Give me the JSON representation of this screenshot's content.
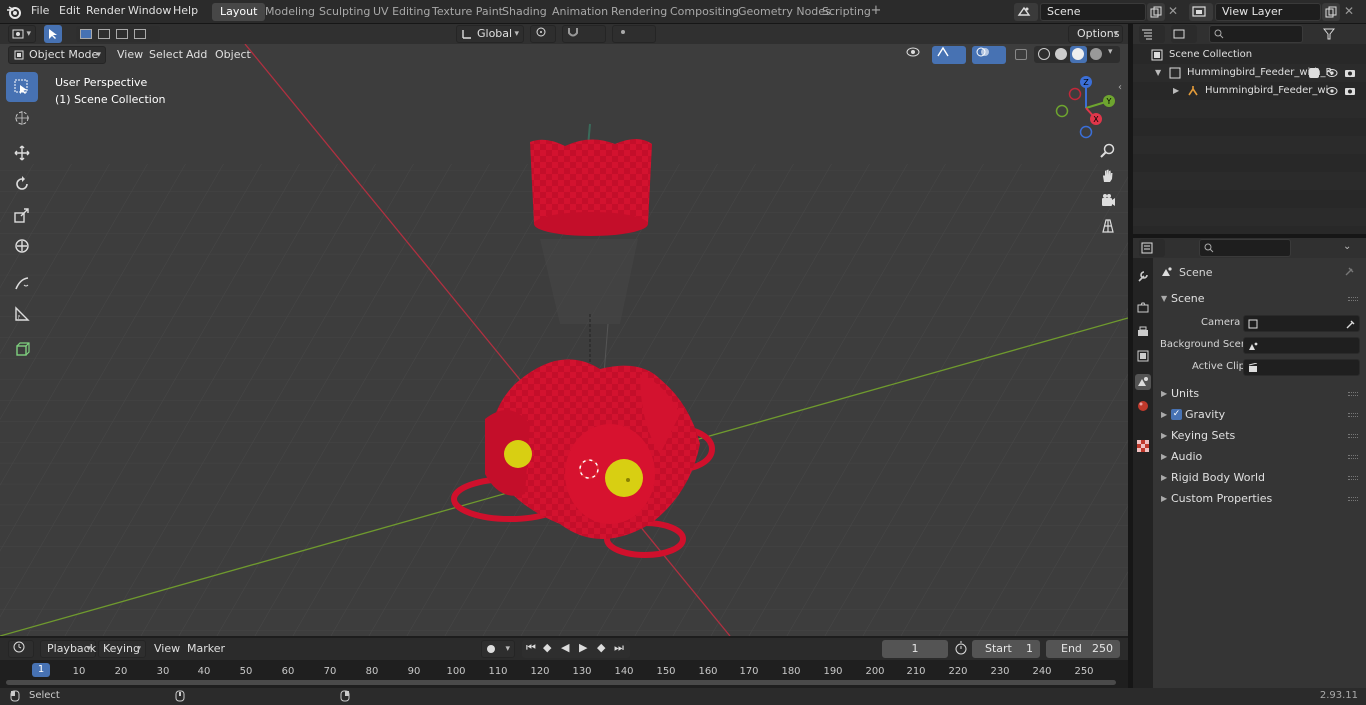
{
  "menu": {
    "file": "File",
    "edit": "Edit",
    "render": "Render",
    "window": "Window",
    "help": "Help"
  },
  "workspaces": [
    {
      "label": "Layout",
      "active": true
    },
    {
      "label": "Modeling"
    },
    {
      "label": "Sculpting"
    },
    {
      "label": "UV Editing"
    },
    {
      "label": "Texture Paint"
    },
    {
      "label": "Shading"
    },
    {
      "label": "Animation"
    },
    {
      "label": "Rendering"
    },
    {
      "label": "Compositing"
    },
    {
      "label": "Geometry Nodes"
    },
    {
      "label": "Scripting"
    }
  ],
  "scene_field": "Scene",
  "view_layer_field": "View Layer",
  "viewport": {
    "mode": "Object Mode",
    "view": "View",
    "select": "Select",
    "add": "Add",
    "object": "Object",
    "orientation": "Global",
    "options": "Options",
    "info_line1": "User Perspective",
    "info_line2": "(1) Scene Collection"
  },
  "gizmo": {
    "x": "X",
    "y": "Y",
    "z": "Z"
  },
  "outliner": {
    "root": "Scene Collection",
    "row1": "Hummingbird_Feeder_with_R",
    "row2": "Hummingbird_Feeder_wi"
  },
  "properties": {
    "header": "Scene",
    "panel_scene": "Scene",
    "camera_label": "Camera",
    "background_label": "Background Scene",
    "clip_label": "Active Clip",
    "panels": [
      "Units",
      "Gravity",
      "Keying Sets",
      "Audio",
      "Rigid Body World",
      "Custom Properties"
    ]
  },
  "timeline": {
    "playback": "Playback",
    "keying": "Keying",
    "view": "View",
    "marker": "Marker",
    "current_frame": "1",
    "start_label": "Start",
    "start_value": "1",
    "end_label": "End",
    "end_value": "250",
    "ticks": [
      "10",
      "20",
      "30",
      "40",
      "50",
      "60",
      "70",
      "80",
      "90",
      "100",
      "110",
      "120",
      "130",
      "140",
      "150",
      "160",
      "170",
      "180",
      "190",
      "200",
      "210",
      "220",
      "230",
      "240",
      "250"
    ]
  },
  "status": {
    "select": "Select",
    "version": "2.93.11"
  },
  "colors": {
    "accent": "#4772b3",
    "model_red": "#d0102c",
    "yellow": "#d8cf12"
  }
}
